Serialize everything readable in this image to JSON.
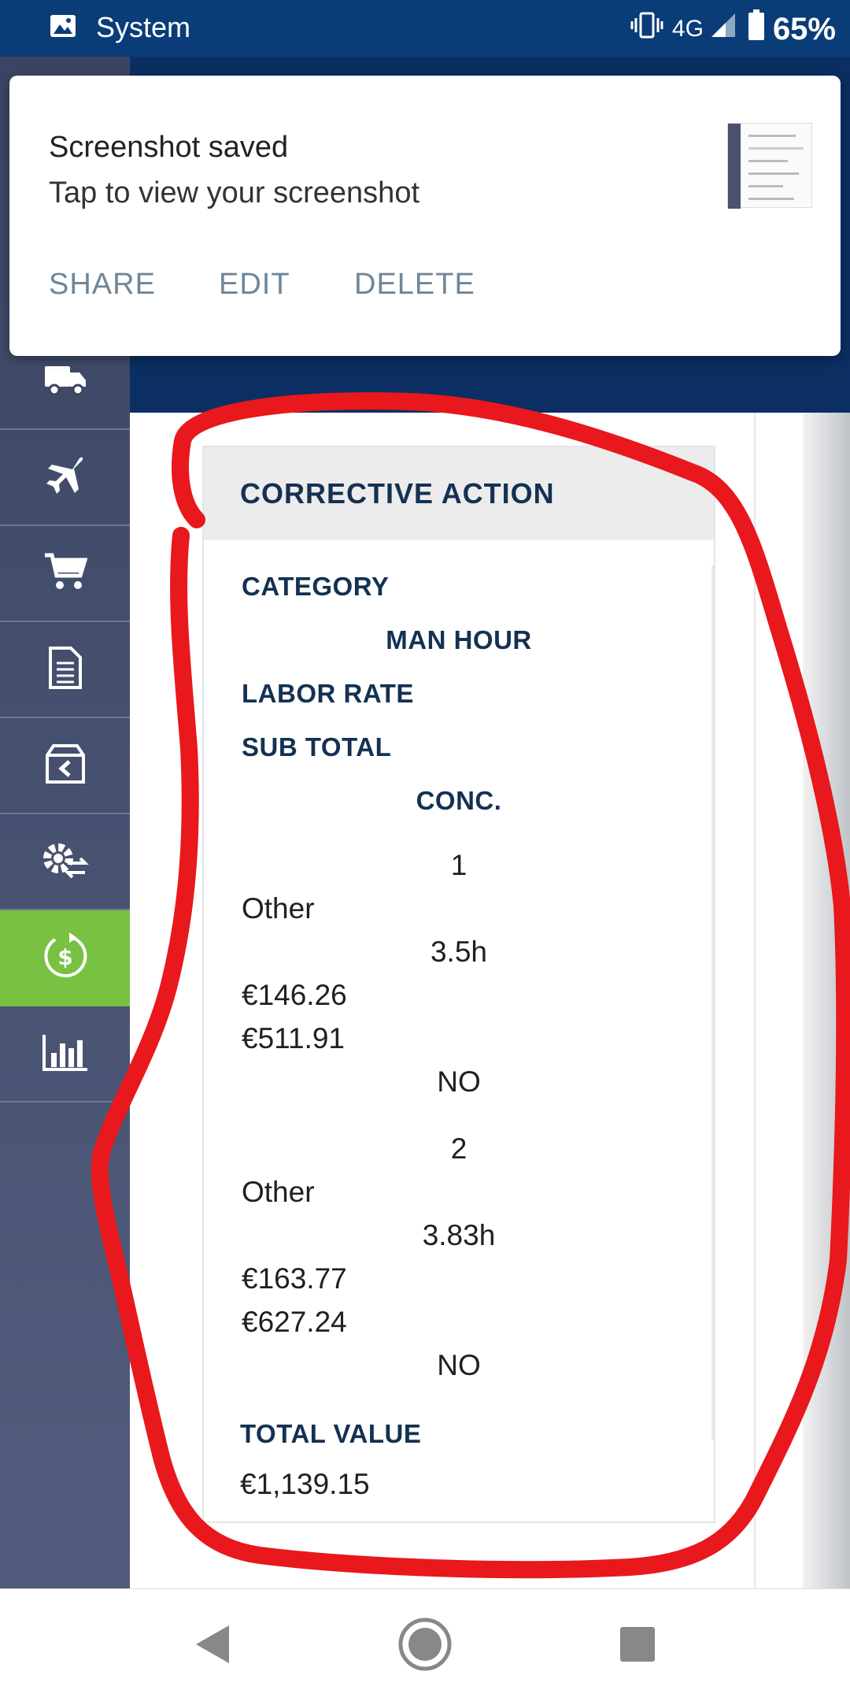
{
  "status_bar": {
    "app_name": "System",
    "network": "4G",
    "battery": "65%"
  },
  "notification": {
    "title": "Screenshot saved",
    "subtitle": "Tap to view your screenshot",
    "actions": [
      "SHARE",
      "EDIT",
      "DELETE"
    ]
  },
  "sidebar": {
    "items": [
      {
        "icon": "truck-icon"
      },
      {
        "icon": "airplane-icon"
      },
      {
        "icon": "cart-icon"
      },
      {
        "icon": "document-icon"
      },
      {
        "icon": "box-return-icon"
      },
      {
        "icon": "gear-exchange-icon"
      },
      {
        "icon": "dollar-refresh-icon",
        "active": true
      },
      {
        "icon": "bar-chart-icon"
      }
    ],
    "active_color": "#79c142"
  },
  "card": {
    "title": "CORRECTIVE ACTION",
    "headers": {
      "category": "CATEGORY",
      "man_hour": "MAN HOUR",
      "labor_rate": "LABOR RATE",
      "sub_total": "SUB TOTAL",
      "conc": "CONC."
    },
    "rows": [
      {
        "index": "1",
        "category": "Other",
        "man_hour": "3.5h",
        "labor_rate": "€146.26",
        "sub_total": "€511.91",
        "conc": "NO"
      },
      {
        "index": "2",
        "category": "Other",
        "man_hour": "3.83h",
        "labor_rate": "€163.77",
        "sub_total": "€627.24",
        "conc": "NO"
      }
    ],
    "total_label": "TOTAL VALUE",
    "total_value": "€1,139.15"
  },
  "colors": {
    "status_bar": "#0a3c78",
    "header": "#0b2f62",
    "label_text": "#143152",
    "annotation": "#e8181c"
  }
}
